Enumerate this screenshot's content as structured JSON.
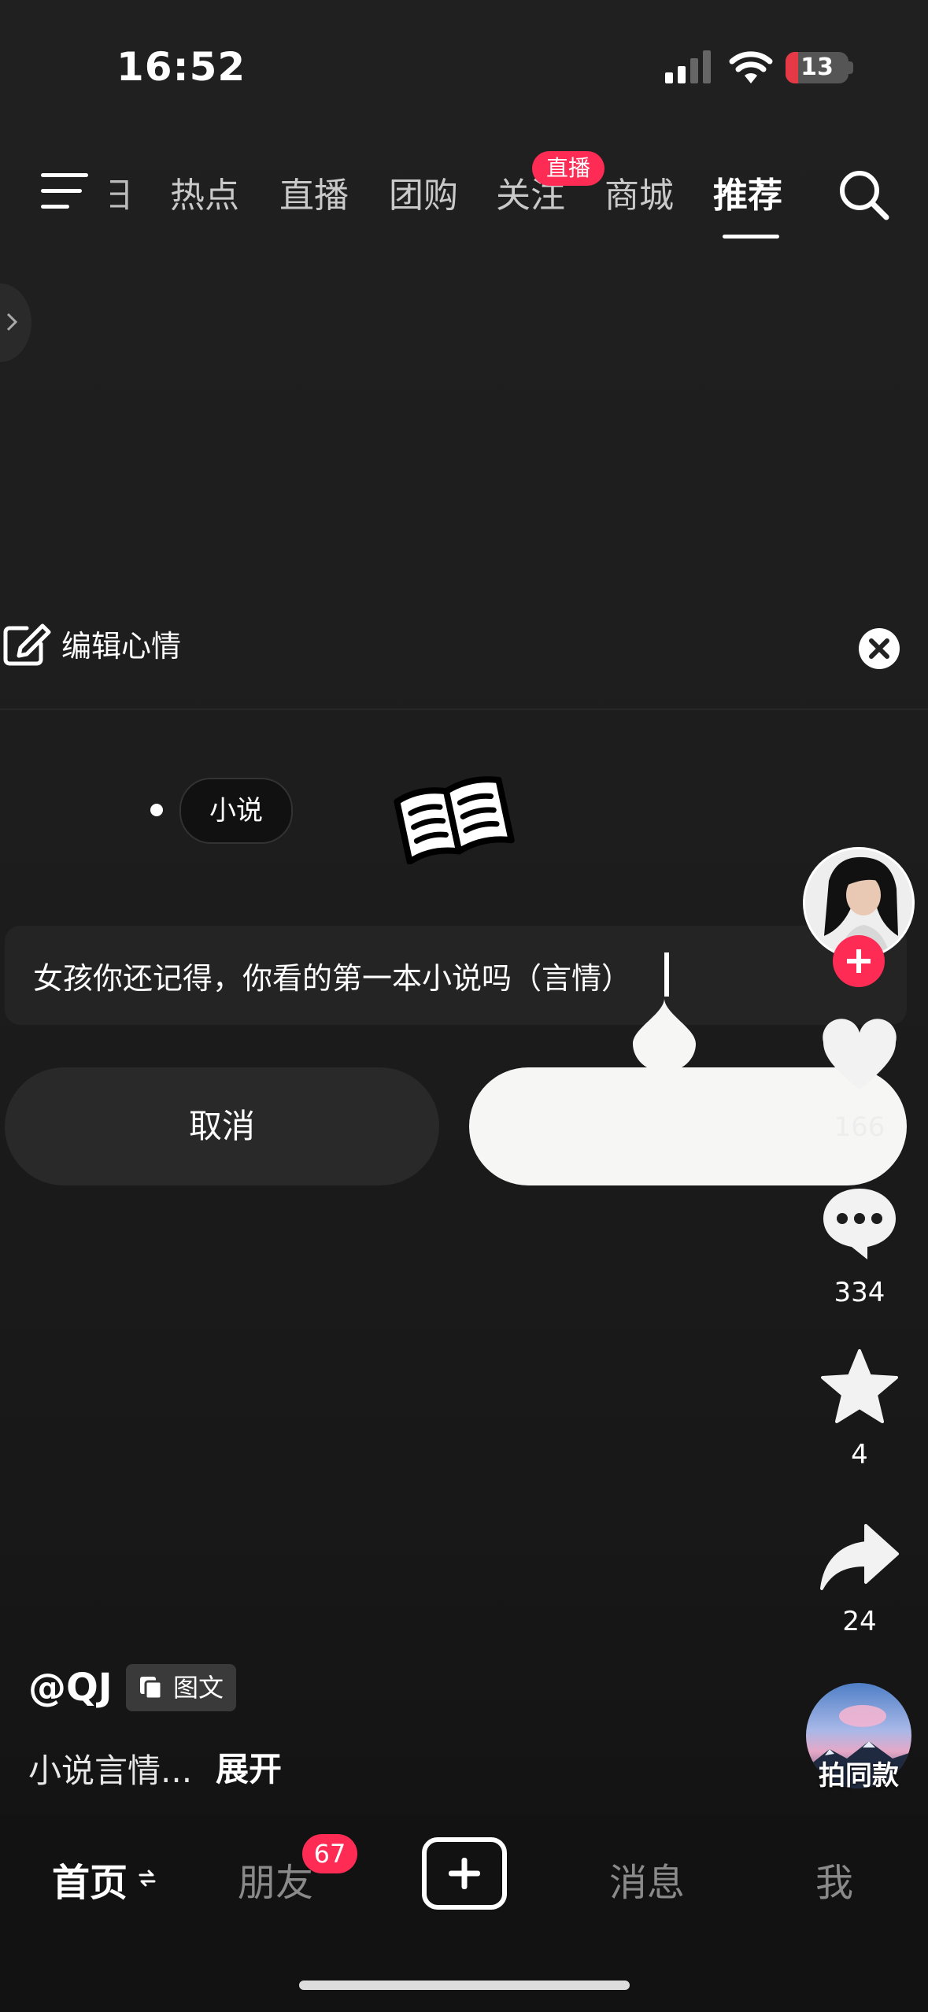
{
  "status_bar": {
    "time": "16:52",
    "battery": "13"
  },
  "top_nav": {
    "partial_tab": "日",
    "tabs": [
      {
        "label": "热点",
        "active": false
      },
      {
        "label": "直播",
        "active": false
      },
      {
        "label": "团购",
        "active": false
      },
      {
        "label": "关注",
        "active": false
      },
      {
        "label": "商城",
        "active": false
      },
      {
        "label": "推荐",
        "active": true
      }
    ],
    "live_badge": "直播"
  },
  "edit_panel": {
    "title": "编辑心情",
    "tag": "小说",
    "text_value": "女孩你还记得，你看的第一本小说吗（言情）",
    "cancel_label": "取消",
    "confirm_label": ""
  },
  "right_rail": {
    "like_count": "166",
    "comment_count": "334",
    "favorite_count": "4",
    "share_count": "24",
    "music_label": "拍同款"
  },
  "post": {
    "author": "@QJ",
    "type_badge": "图文",
    "description": "小说言情...",
    "expand_label": "展开"
  },
  "tab_bar": {
    "home": "首页",
    "friends": "朋友",
    "friends_badge": "67",
    "messages": "消息",
    "me": "我"
  },
  "colors": {
    "accent": "#fe2c55",
    "background": "#1e1e1e"
  }
}
